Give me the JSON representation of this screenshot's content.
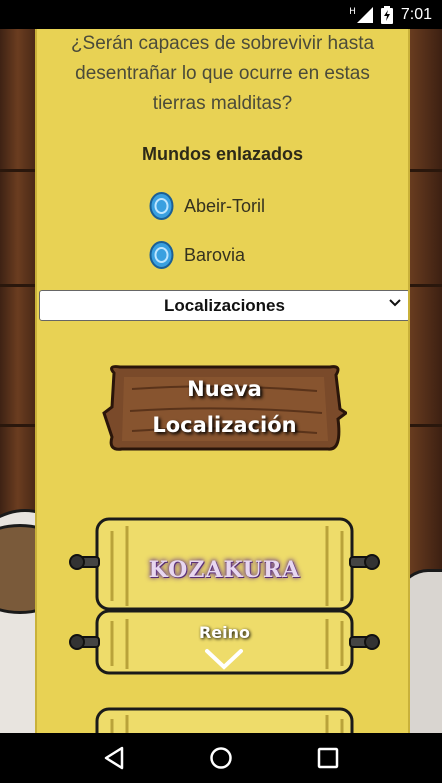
{
  "status_bar": {
    "time": "7:01",
    "network_label": "H"
  },
  "intro_text": [
    "¿Serán capaces de sobrevivir hasta",
    "desentrañar lo que ocurre en estas",
    "tierras malditas?"
  ],
  "linked_worlds": {
    "title": "Mundos enlazados",
    "items": [
      {
        "label": "Abeir-Toril",
        "icon": "blue-gem-icon"
      },
      {
        "label": "Barovia",
        "icon": "blue-gem-icon"
      }
    ]
  },
  "select": {
    "value": "Localizaciones"
  },
  "new_location_button": {
    "line1": "Nueva",
    "line2": "Localización"
  },
  "location_card": {
    "name": "KOZAKURA",
    "type": "Reino"
  },
  "colors": {
    "panel": "#e8d254",
    "wood": "#6e4023",
    "scroll": "#eedc6a",
    "accent_gem": "#3aa0e0"
  }
}
